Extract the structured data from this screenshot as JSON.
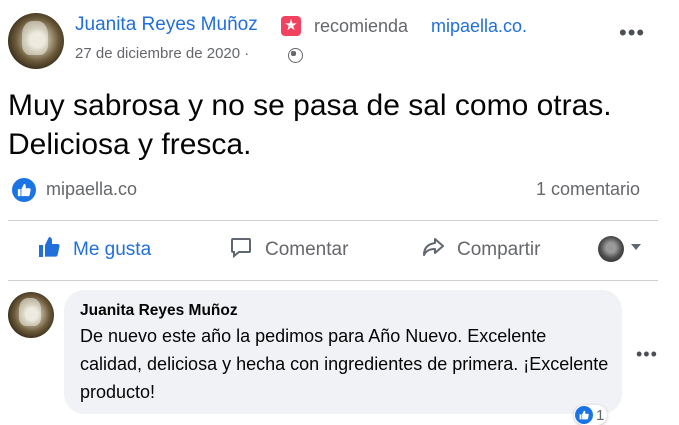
{
  "post": {
    "author_name": "Juanita Reyes Muñoz",
    "recommends_text": "recomienda",
    "page_name": "mipaella.co.",
    "date": "27 de diciembre de 2020 ·",
    "more_glyph": "•••",
    "text": "Muy sabrosa y no se pasa de sal como otras. Deliciosa y fresca."
  },
  "reactions": {
    "page_name": "mipaella.co",
    "comment_count": "1 comentario"
  },
  "actions": {
    "like_label": "Me gusta",
    "comment_label": "Comentar",
    "share_label": "Compartir"
  },
  "comment": {
    "author_name": "Juanita Reyes Muñoz",
    "text": "De nuevo este año la pedimos para Año Nuevo. Excelente calidad, deliciosa y hecha con ingredientes de primera. ¡Excelente producto!",
    "more_glyph": "•••",
    "reaction_count": "1"
  },
  "colors": {
    "link_blue": "#216fdb",
    "like_blue": "#1b74e4",
    "badge_pink": "#f3425f",
    "secondary_text": "#65676b",
    "bubble_bg": "#f0f2f5"
  }
}
